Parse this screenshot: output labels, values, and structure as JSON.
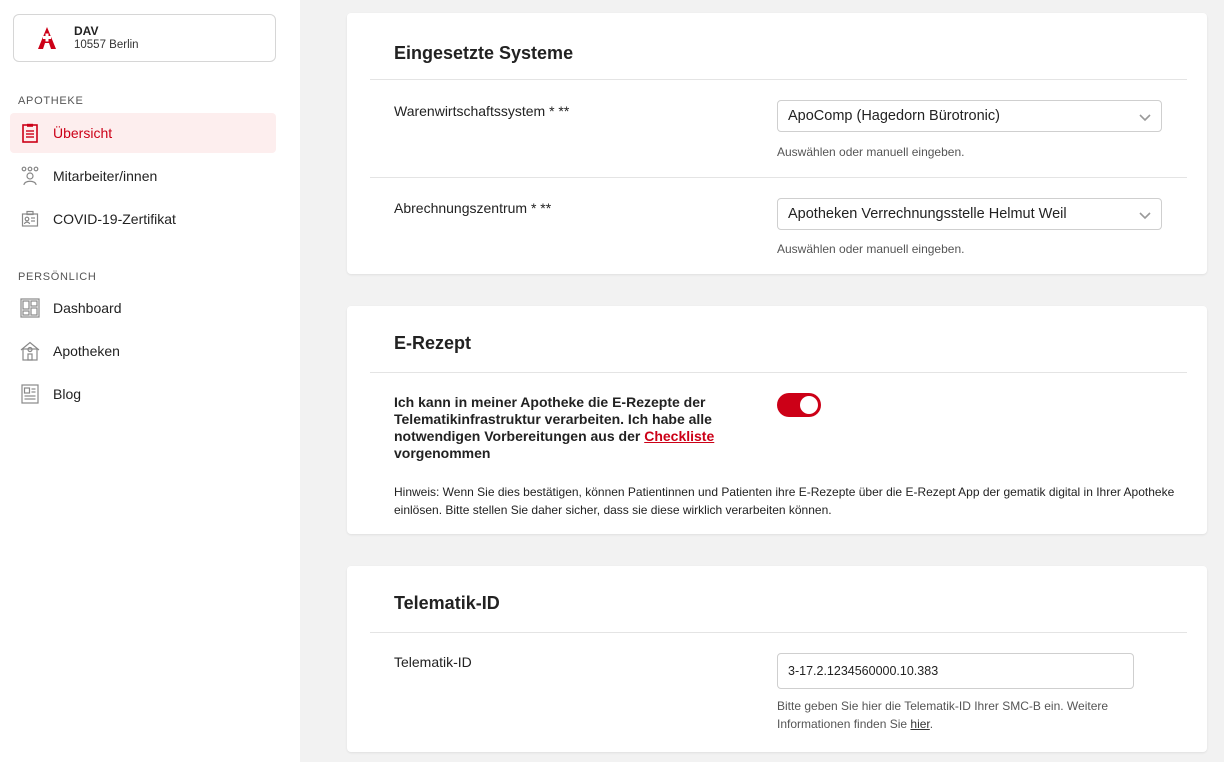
{
  "account": {
    "name": "DAV",
    "city": "10557 Berlin"
  },
  "sidebar": {
    "sections": [
      {
        "label": "APOTHEKE"
      },
      {
        "label": "PERSÖNLICH"
      }
    ],
    "items": [
      {
        "label": "Übersicht",
        "icon": "clipboard-icon",
        "active": true
      },
      {
        "label": "Mitarbeiter/innen",
        "icon": "team-icon"
      },
      {
        "label": "COVID-19-Zertifikat",
        "icon": "certificate-icon"
      },
      {
        "label": "Dashboard",
        "icon": "dashboard-icon"
      },
      {
        "label": "Apotheken",
        "icon": "pharmacy-building-icon"
      },
      {
        "label": "Blog",
        "icon": "blog-icon"
      }
    ]
  },
  "systems": {
    "title": "Eingesetzte Systeme",
    "rows": [
      {
        "label": "Warenwirtschaftssystem * **",
        "value": "ApoComp (Hagedorn Bürotronic)",
        "help": "Auswählen oder manuell eingeben."
      },
      {
        "label": "Abrechnungszentrum * **",
        "value": "Apotheken Verrechnungsstelle Helmut Weil",
        "help": "Auswählen oder manuell eingeben."
      }
    ]
  },
  "erezept": {
    "title": "E-Rezept",
    "text_before": "Ich kann in meiner Apotheke die E-Rezepte der Telematikinfrastruktur verarbeiten. Ich habe alle notwendigen Vorbereitungen aus der ",
    "link": "Checkliste",
    "text_after": " vorgenommen",
    "toggle_on": true,
    "hint": "Hinweis: Wenn Sie dies bestätigen, können Patientinnen und Patienten ihre E-Rezepte über die E-Rezept App der gematik digital in Ihrer Apotheke einlösen. Bitte stellen Sie daher sicher, dass sie diese wirklich verarbeiten können."
  },
  "telematik": {
    "title": "Telematik-ID",
    "label": "Telematik-ID",
    "value": "3-17.2.1234560000.10.383",
    "help_before": "Bitte geben Sie hier die Telematik-ID Ihrer SMC-B ein. Weitere Informationen finden Sie ",
    "help_link": "hier",
    "help_after": "."
  },
  "colors": {
    "accent": "#cc0017",
    "active_bg": "#fdeeee"
  }
}
